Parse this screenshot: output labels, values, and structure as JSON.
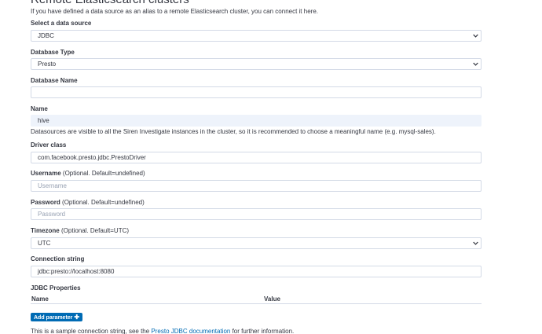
{
  "page": {
    "heading": "Remote Elasticsearch clusters",
    "subtext": "If you have defined a data source as an alias to a remote Elasticsearch cluster, you can connect it here."
  },
  "form": {
    "data_source": {
      "label": "Select a data source",
      "value": "JDBC"
    },
    "database_type": {
      "label": "Database Type",
      "value": "Presto"
    },
    "database_name": {
      "label": "Database Name",
      "value": ""
    },
    "name": {
      "label": "Name",
      "value": "hive",
      "help": "Datasources are visible to all the Siren Investigate instances in the cluster, so it is recommended to choose a meaningful name (e.g. mysql-sales)."
    },
    "driver_class": {
      "label": "Driver class",
      "value": "com.facebook.presto.jdbc.PrestoDriver"
    },
    "username": {
      "label": "Username",
      "hint": "(Optional. Default=undefined)",
      "placeholder": "Username"
    },
    "password": {
      "label": "Password",
      "hint": "(Optional. Default=undefined)",
      "placeholder": "Password"
    },
    "timezone": {
      "label": "Timezone",
      "hint": "(Optional. Default=UTC)",
      "value": "UTC"
    },
    "connection_string": {
      "label": "Connection string",
      "value": "jdbc:presto://localhost:8080"
    }
  },
  "jdbc_properties": {
    "title": "JDBC Properties",
    "columns": [
      "Name",
      "Value"
    ],
    "add_button": "Add parameter",
    "add_icon": "plus-icon"
  },
  "footer": {
    "prefix": "This is a sample connection string, see the ",
    "link": "Presto JDBC documentation",
    "suffix": " for further information."
  },
  "icons": {
    "select_arrow": "chevron-down-icon"
  },
  "colors": {
    "accent": "#006bb4",
    "text": "#343741",
    "border": "#d3dae6",
    "filled_bg": "#eef3fb"
  }
}
